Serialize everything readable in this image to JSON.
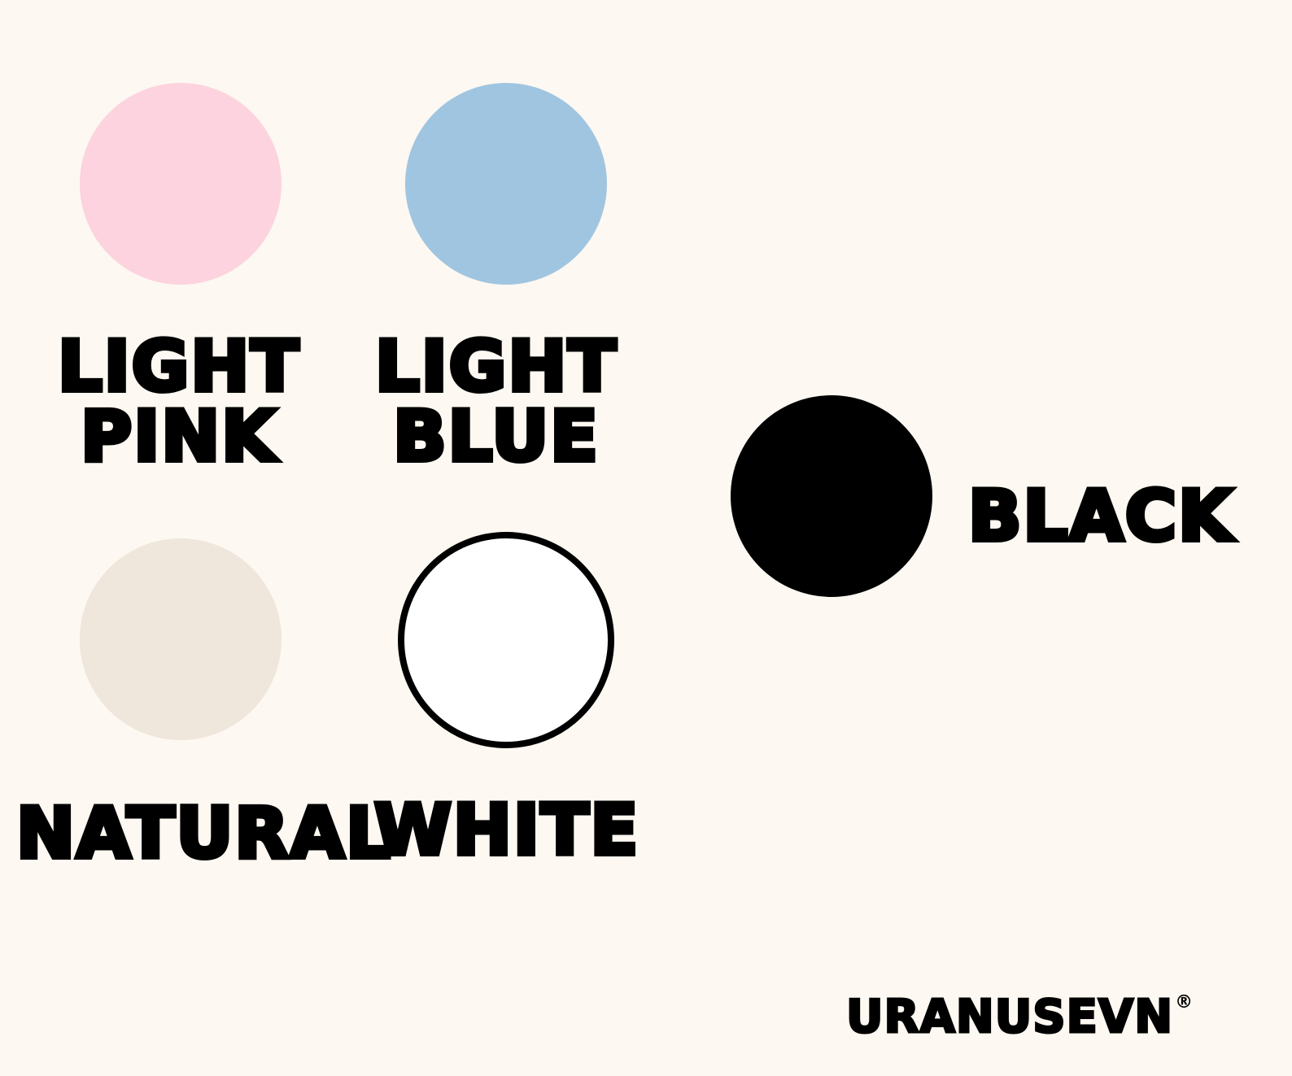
{
  "swatches": [
    {
      "name": "light-pink",
      "label_lines": [
        "LIGHT",
        "PINK"
      ],
      "color": "#fcd3df"
    },
    {
      "name": "light-blue",
      "label_lines": [
        "LIGHT",
        "BLUE"
      ],
      "color": "#a0c5e1"
    },
    {
      "name": "natural",
      "label_lines": [
        "NATURAL"
      ],
      "color": "#efe6dc"
    },
    {
      "name": "white",
      "label_lines": [
        "WHITE"
      ],
      "color": "#ffffff",
      "border": "#000000"
    },
    {
      "name": "black",
      "label_lines": [
        "BLACK"
      ],
      "color": "#000000"
    }
  ],
  "brand": {
    "name": "URANUSEVN",
    "mark": "®"
  },
  "background": "#fdf8f1"
}
